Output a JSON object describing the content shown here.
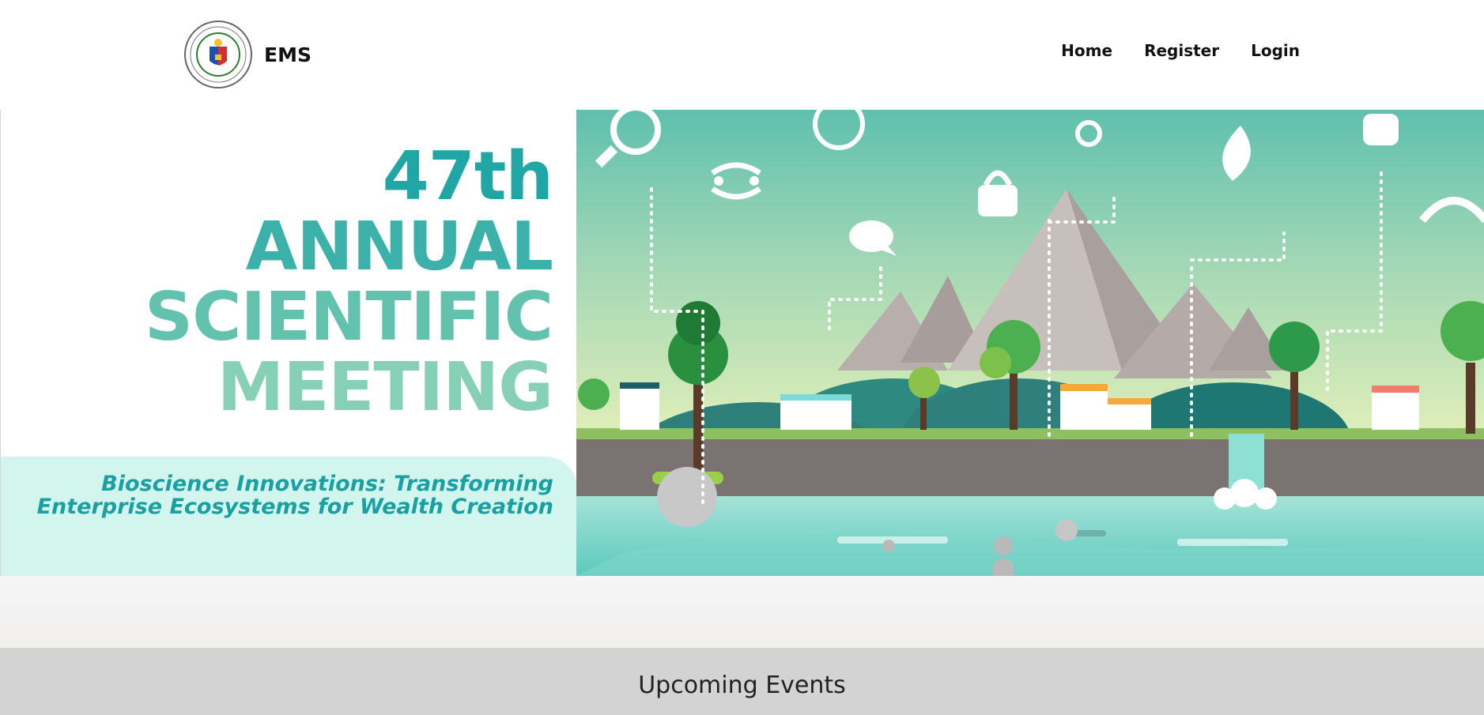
{
  "brand": {
    "name": "EMS",
    "logo_icon": "nast-seal-logo"
  },
  "nav": {
    "home": "Home",
    "register": "Register",
    "login": "Login"
  },
  "hero": {
    "title_line1": "47th",
    "title_line2": "ANNUAL",
    "title_line3": "SCIENTIFIC",
    "title_line4": "MEETING",
    "subtitle_line1": "Bioscience Innovations: Transforming",
    "subtitle_line2": "Enterprise Ecosystems for Wealth Creation",
    "illustration": "bioscience-landscape-illustration"
  },
  "events": {
    "heading": "Upcoming Events"
  },
  "colors": {
    "teal": "#21a6a6",
    "mint": "#d2f5ee",
    "gray_band": "#d3d3d3"
  }
}
